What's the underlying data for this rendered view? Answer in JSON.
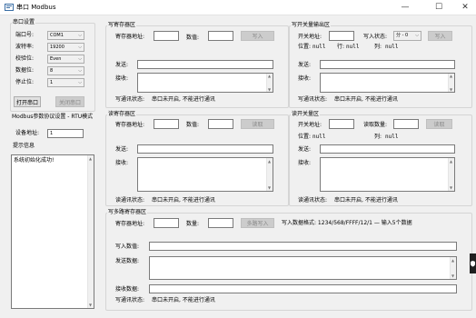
{
  "window": {
    "title": "串口 Modbus",
    "minimize": "—",
    "maximize": "☐",
    "close": "✕"
  },
  "serial": {
    "group_title": "串口设置",
    "port_label": "端口号:",
    "port_value": "COM1",
    "baud_label": "波特率:",
    "baud_value": "19200",
    "parity_label": "校验位:",
    "parity_value": "Even",
    "databits_label": "数据位:",
    "databits_value": "8",
    "stopbits_label": "停止位:",
    "stopbits_value": "1",
    "open_button": "打开串口",
    "close_button": "关闭串口"
  },
  "modbus": {
    "mode_text": "Modbus参数协议设置 - RTU模式",
    "device_label": "设备地址:",
    "device_value": "1"
  },
  "info": {
    "group_title": "提示信息",
    "message": "系统初始化成功!"
  },
  "write_reg": {
    "group_title": "写寄存器区",
    "addr_label": "寄存器地址:",
    "value_label": "数值:",
    "write_button": "写入",
    "send_label": "发送:",
    "recv_label": "接收:",
    "status_label": "写通讯状态:",
    "status_text": "串口未开启, 不能进行通讯"
  },
  "read_reg": {
    "group_title": "读寄存器区",
    "addr_label": "寄存器地址:",
    "count_label": "数值:",
    "read_button": "读取",
    "send_label": "发送:",
    "recv_label": "接收:",
    "status_label": "读通讯状态:",
    "status_text": "串口未开启, 不能进行通讯"
  },
  "write_coil": {
    "group_title": "写开关量输出区",
    "addr_label": "开关地址:",
    "state_label": "写入状态:",
    "state_value": "分 - 0",
    "write_button": "写入",
    "pos_label": "位置:",
    "pos_value": "null",
    "row_label": "行:",
    "row_value": "null",
    "col_label": "列:",
    "col_value": "null",
    "send_label": "发送:",
    "recv_label": "接收:",
    "status_label": "写通讯状态:",
    "status_text": "串口未开启, 不能进行通讯"
  },
  "read_coil": {
    "group_title": "读开关量区",
    "addr_label": "开关地址:",
    "count_label": "读取数量:",
    "read_button": "读取",
    "pos_label": "位置:",
    "pos_value": "null",
    "col_label": "列:",
    "col_value": "null",
    "send_label": "发送:",
    "recv_label": "接收:",
    "status_label": "读通讯状态:",
    "status_text": "串口未开启, 不能进行通讯"
  },
  "multi_reg": {
    "group_title": "写多路寄存器区",
    "addr_label": "寄存器地址:",
    "count_label": "数量:",
    "write_button": "多路写入",
    "format_text": "写入数据格式: 1234/568/FFFF/12/1 — 输入5个数据",
    "data_label": "写入数值:",
    "send_label": "发送数据:",
    "recv_label": "接收数据:",
    "status_label": "写通讯状态:",
    "status_text": "串口未开启, 不能进行通讯"
  }
}
